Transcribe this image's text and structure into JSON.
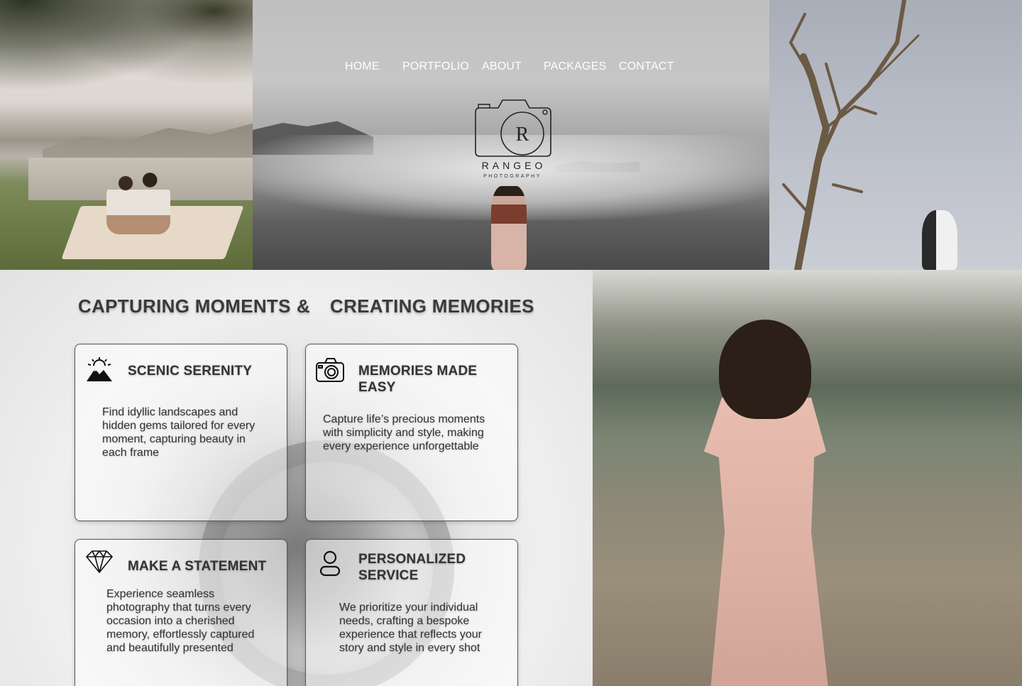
{
  "nav": {
    "home": "HOME",
    "portfolio": "PORTFOLIO",
    "about": "ABOUT",
    "packages": "PACKAGES",
    "contact": "CONTACT"
  },
  "logo": {
    "brand": "RANGEO",
    "tagline": "PHOTOGRAPHY"
  },
  "hero_heading": {
    "left": "CAPTURING MOMENTS",
    "amp": "&",
    "right": "CREATING MEMORIES"
  },
  "cards": [
    {
      "icon": "sun-mountain-icon",
      "title": "SCENIC SERENITY",
      "description": "Find idyllic landscapes and hidden gems tailored for every moment, capturing beauty in each frame"
    },
    {
      "icon": "camera-icon",
      "title": "MEMORIES MADE EASY",
      "description": "Capture life’s precious moments with simplicity and style, making every experience unforgettable"
    },
    {
      "icon": "diamond-icon",
      "title": "MAKE A STATEMENT",
      "description": "Experience seamless photography that turns every occasion into a cherished memory, effortlessly captured and beautifully presented"
    },
    {
      "icon": "person-icon",
      "title": "PERSONALIZED SERVICE",
      "description": "We prioritize your individual needs, crafting a bespoke experience that reflects your story and style in every shot"
    }
  ],
  "colors": {
    "nav_text": "#ffffff",
    "heading_text": "#3a3a3a",
    "card_border": "#555555",
    "card_text": "#333333"
  }
}
